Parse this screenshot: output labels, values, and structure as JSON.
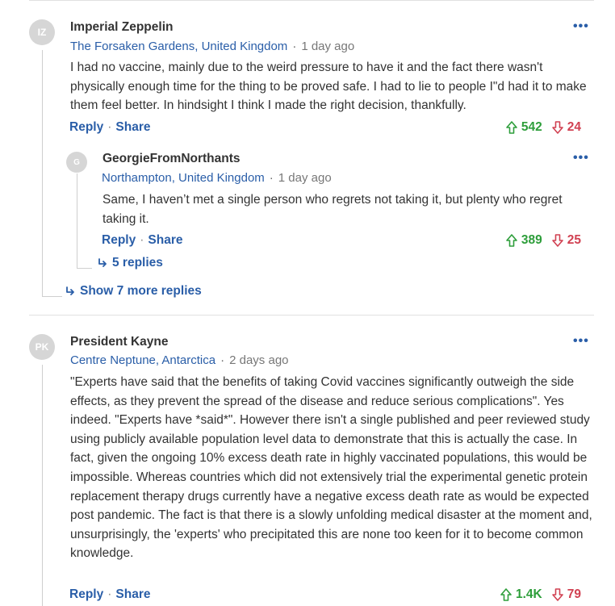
{
  "comments": [
    {
      "initials": "IZ",
      "author": "Imperial Zeppelin",
      "location": "The Forsaken Gardens, United Kingdom",
      "time": "1 day ago",
      "text": "I had no vaccine, mainly due to the weird pressure to have it and the fact there wasn't physically enough time for the thing to be proved safe. I had to lie to people I\"d had it to make them feel better. In hindsight I think I made the right decision, thankfully.",
      "reply_label": "Reply",
      "share_label": "Share",
      "upvotes": "542",
      "downvotes": "24",
      "replies": [
        {
          "initials": "G",
          "author": "GeorgieFromNorthants",
          "location": "Northampton, United Kingdom",
          "time": "1 day ago",
          "text": "Same, I haven’t met a single person who regrets not taking it, but plenty who regret taking it.",
          "reply_label": "Reply",
          "share_label": "Share",
          "upvotes": "389",
          "downvotes": "25",
          "replies_link": "5 replies"
        }
      ],
      "more_replies_link": "Show 7 more replies"
    },
    {
      "initials": "PK",
      "author": "President Kayne",
      "location": "Centre Neptune, Antarctica",
      "time": "2 days ago",
      "text": "\"Experts have said that the benefits of taking Covid vaccines significantly outweigh the side effects, as they prevent the spread of the disease and reduce serious complications\". Yes indeed. \"Experts have *said*\". However there isn't a single published and peer reviewed study using publicly available population level data to demonstrate that this is actually the case. In fact, given the ongoing 10% excess death rate in highly vaccinated populations, this would be impossible. Whereas countries which did not extensively trial the experimental genetic protein replacement therapy drugs currently have a negative excess death rate as would be expected post pandemic. The fact is that there is a slowly unfolding medical disaster at the moment and, unsurprisingly, the 'experts' who precipitated this are none too keen for it to become common knowledge.",
      "reply_label": "Reply",
      "share_label": "Share",
      "upvotes": "1.4K",
      "downvotes": "79"
    }
  ],
  "more_menu_glyph": "•••",
  "separator": "·",
  "colors": {
    "link_blue": "#2a5ea8",
    "upvote_green": "#2e9e3b",
    "downvote_red": "#d14152",
    "avatar_grey": "#d6d6d6"
  }
}
